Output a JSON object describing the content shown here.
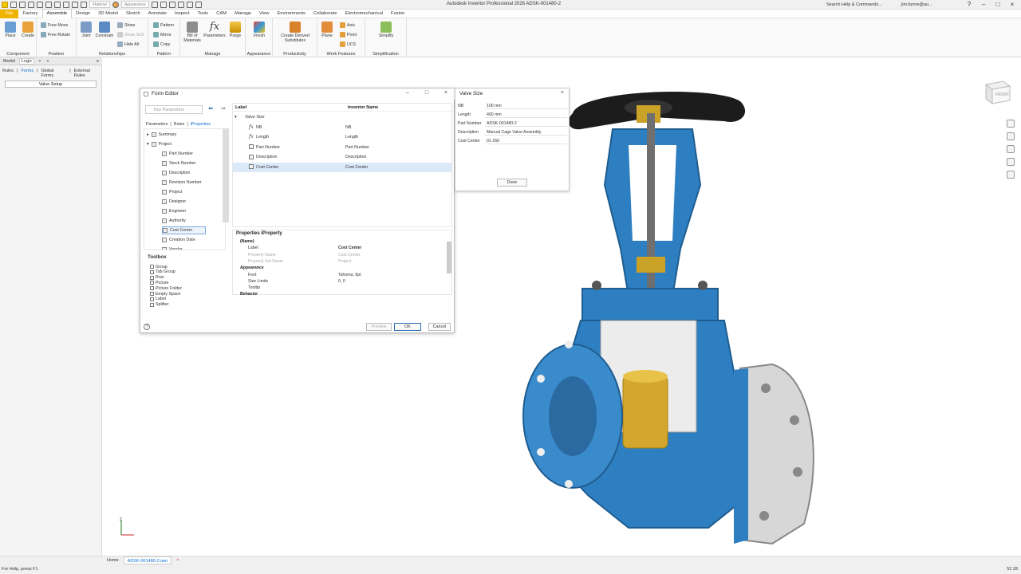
{
  "app": {
    "title": "Autodesk Inventor Professional 2026   ADSK-001480-2",
    "search_placeholder": "Search Help & Commands...",
    "user": "jim.byrne@au...",
    "material_dropdown": "Material",
    "appearance_dropdown": "Appearance"
  },
  "menu_tabs": [
    "File",
    "Factory",
    "Assemble",
    "Design",
    "3D Model",
    "Sketch",
    "Annotate",
    "Inspect",
    "Tools",
    "CAM",
    "Manage",
    "View",
    "Environments",
    "Collaborate",
    "Electromechanical",
    "Fusion"
  ],
  "ribbon": {
    "component": {
      "label": "Component",
      "place": "Place",
      "create": "Create"
    },
    "position": {
      "label": "Position",
      "free_move": "Free Move",
      "free_rotate": "Free Rotate"
    },
    "relationships": {
      "label": "Relationships",
      "joint": "Joint",
      "constrain": "Constrain",
      "show": "Show",
      "show_sick": "Show Sick",
      "hide_all": "Hide All"
    },
    "pattern": {
      "label": "Pattern",
      "pattern": "Pattern",
      "mirror": "Mirror",
      "copy": "Copy"
    },
    "manage": {
      "label": "Manage",
      "bom_line1": "Bill of",
      "bom_line2": "Materials",
      "parameters": "Parameters",
      "purge": "Purge"
    },
    "appearance": {
      "label": "Appearance",
      "finish": "Finish"
    },
    "productivity": {
      "label": "Productivity",
      "cds_line1": "Create Derived",
      "cds_line2": "Substitutes"
    },
    "work_features": {
      "label": "Work Features",
      "plane": "Plane",
      "axis": "Axis",
      "point": "Point",
      "ucs": "UCS"
    },
    "simplification": {
      "label": "Simplification",
      "simplify": "Simplify"
    }
  },
  "left_panel": {
    "tabs": [
      "Model",
      "Logic"
    ],
    "subtabs": [
      "Rules",
      "Forms",
      "Global Forms",
      "External Rules"
    ],
    "active_subtab": "Forms",
    "valve_setup": "Valve Setup"
  },
  "form_editor": {
    "title": "Form Editor",
    "key_parameters_placeholder": "Key Parameters",
    "panel_tabs": [
      "Parameters",
      "Rules",
      "iProperties"
    ],
    "active_panel_tab": "iProperties",
    "tree": [
      {
        "label": "Summary",
        "level": 1,
        "expander": "+"
      },
      {
        "label": "Project",
        "level": 1,
        "expander": "-"
      },
      {
        "label": "Part Number",
        "level": 2
      },
      {
        "label": "Stock Number",
        "level": 2
      },
      {
        "label": "Description",
        "level": 2
      },
      {
        "label": "Revision Number",
        "level": 2
      },
      {
        "label": "Project",
        "level": 2
      },
      {
        "label": "Designer",
        "level": 2
      },
      {
        "label": "Engineer",
        "level": 2
      },
      {
        "label": "Authority",
        "level": 2
      },
      {
        "label": "Cost Center",
        "level": 2,
        "selected": true
      },
      {
        "label": "Creation Date",
        "level": 2
      },
      {
        "label": "Vendor",
        "level": 2
      }
    ],
    "toolbox_title": "Toolbox",
    "toolbox_items": [
      "Group",
      "Tab Group",
      "Row",
      "Picture",
      "Picture Folder",
      "Empty Space",
      "Label",
      "Splitter"
    ],
    "form_tree_headers": {
      "label": "Label",
      "inventor_name": "Inventor Name"
    },
    "form_tree": [
      {
        "label": "Valve Size",
        "inventor_name": "",
        "kind": "group"
      },
      {
        "label": "NB",
        "inventor_name": "NB",
        "kind": "param"
      },
      {
        "label": "Length",
        "inventor_name": "Length",
        "kind": "param"
      },
      {
        "label": "Part Number",
        "inventor_name": "Part Number",
        "kind": "iprop"
      },
      {
        "label": "Description",
        "inventor_name": "Description",
        "kind": "iprop"
      },
      {
        "label": "Cost Center",
        "inventor_name": "Cost Center",
        "kind": "iprop",
        "selected": true
      }
    ],
    "properties_title": "Properties  iProperty",
    "properties": [
      {
        "name": "(Name)",
        "value": "",
        "kind": "cat"
      },
      {
        "name": "Label",
        "value": "Cost Center",
        "kind": "bold"
      },
      {
        "name": "Property Name",
        "value": "Cost Center",
        "kind": "dim"
      },
      {
        "name": "Property Set Name",
        "value": "Project",
        "kind": "dim"
      },
      {
        "name": "Appearance",
        "value": "",
        "kind": "cat"
      },
      {
        "name": "Font",
        "value": "Tahoma, 6pt",
        "kind": "normal"
      },
      {
        "name": "Size Limits",
        "value": "0, 0",
        "kind": "normal"
      },
      {
        "name": "Tooltip",
        "value": "",
        "kind": "normal"
      },
      {
        "name": "Behavior",
        "value": "",
        "kind": "cat"
      }
    ],
    "buttons": {
      "preview": "Preview",
      "ok": "OK",
      "cancel": "Cancel"
    }
  },
  "valve_size_form": {
    "title": "Valve Size",
    "rows": [
      {
        "label": "NB",
        "value": "100 mm"
      },
      {
        "label": "Length",
        "value": "400 mm"
      },
      {
        "label": "Part Number",
        "value": "ADSK-001480-2"
      },
      {
        "label": "Description",
        "value": "Manual Cage Valve Assembly"
      },
      {
        "label": "Cost Center",
        "value": "01-256"
      }
    ],
    "done": "Done"
  },
  "viewcube": {
    "face": "FRONT"
  },
  "status": {
    "help": "For Help, press F1",
    "home_tab": "Home",
    "doc_tab": "ADSK-001480-2.iam",
    "coords": "52   28"
  },
  "colors": {
    "accent": "#0a6ed1",
    "file_tab": "#f0b400",
    "valve_body": "#2e7fc1",
    "handwheel": "#1a1a1a",
    "brass": "#d4a72c"
  }
}
